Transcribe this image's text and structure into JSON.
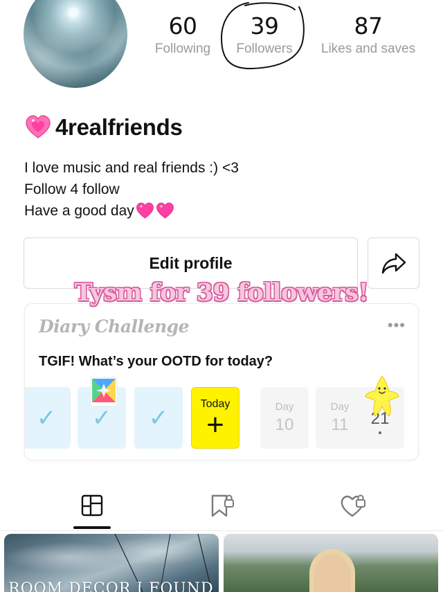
{
  "stats": {
    "following": {
      "value": "60",
      "label": "Following"
    },
    "followers": {
      "value": "39",
      "label": "Followers"
    },
    "likes": {
      "value": "87",
      "label": "Likes and saves"
    }
  },
  "profile": {
    "username": "4realfriends",
    "bio": [
      "I love music and real friends  :) <3",
      "Follow 4 follow",
      "Have a good day"
    ]
  },
  "actions": {
    "edit_label": "Edit profile"
  },
  "overlay": {
    "text": "Tysm for 39 followers!"
  },
  "diary": {
    "logo": "Diary Challenge",
    "more": "•••",
    "prompt": "TGIF! What’s your OOTD for today?",
    "days": [
      {
        "state": "done",
        "mark": "✓"
      },
      {
        "state": "done",
        "mark": "✓"
      },
      {
        "state": "done",
        "mark": "✓"
      },
      {
        "state": "today",
        "label": "Today",
        "mark": "+"
      },
      {
        "state": "future",
        "label": "Day",
        "num": "10"
      },
      {
        "state": "future",
        "label": "Day",
        "num": "11"
      },
      {
        "state": "future",
        "num": "21"
      }
    ]
  },
  "tabs": [
    {
      "name": "notes",
      "icon": "grid-layout-icon",
      "active": true
    },
    {
      "name": "collects",
      "icon": "bookmark-lock-icon",
      "active": false
    },
    {
      "name": "likes",
      "icon": "heart-lock-icon",
      "active": false
    }
  ],
  "posts": [
    {
      "caption": "ROOM DECOR I FOUND ON"
    },
    {
      "caption": ""
    }
  ],
  "colors": {
    "overlay_fill": "#f8c6df",
    "overlay_outline": "#d65a9a",
    "check_blue": "#7dc6e6",
    "today_yellow": "#fff200",
    "heart_pink": "#ff3fa4"
  }
}
